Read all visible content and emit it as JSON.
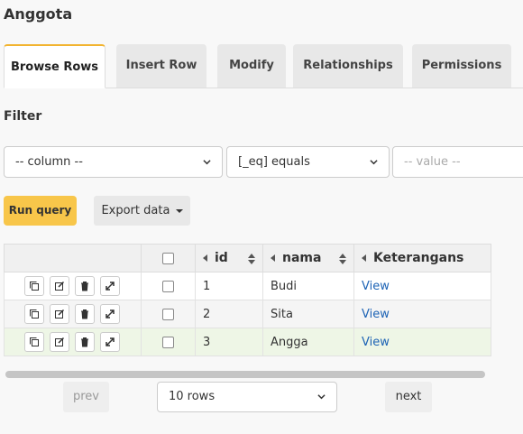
{
  "page": {
    "title": "Anggota"
  },
  "tabs": [
    {
      "label": "Browse Rows",
      "active": true
    },
    {
      "label": "Insert Row"
    },
    {
      "label": "Modify"
    },
    {
      "label": "Relationships"
    },
    {
      "label": "Permissions"
    }
  ],
  "filter": {
    "title": "Filter",
    "column_select": "-- column --",
    "operator_select": "[_eq] equals",
    "value_placeholder": "-- value --"
  },
  "actions": {
    "run_query": "Run query",
    "export_data": "Export data"
  },
  "table": {
    "columns": [
      "id",
      "nama",
      "Keterangans"
    ],
    "rows": [
      {
        "id": "1",
        "nama": "Budi",
        "keterangans": "View"
      },
      {
        "id": "2",
        "nama": "Sita",
        "keterangans": "View"
      },
      {
        "id": "3",
        "nama": "Angga",
        "keterangans": "View"
      }
    ]
  },
  "pagination": {
    "prev": "prev",
    "rows_select": "10 rows",
    "next": "next"
  },
  "colors": {
    "accent": "#f8c64a",
    "link": "#1d63b5",
    "highlight_row": "#eef6e6"
  }
}
